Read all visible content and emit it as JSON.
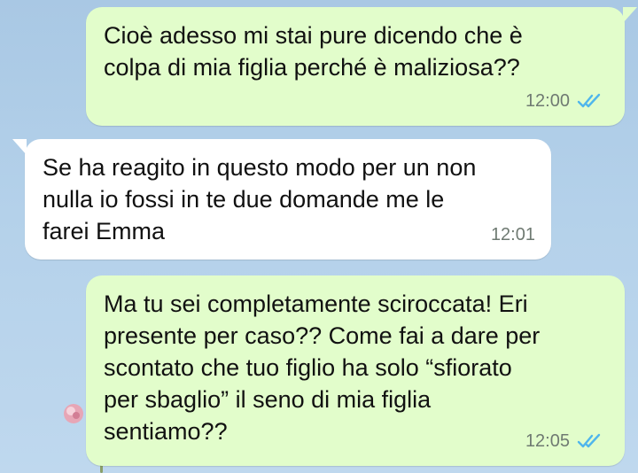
{
  "messages": [
    {
      "direction": "outgoing",
      "text_lines": [
        "Cioè adesso mi stai pure dicendo che è",
        "colpa di mia figlia perché è maliziosa??"
      ],
      "time": "12:00",
      "status": "read"
    },
    {
      "direction": "incoming",
      "text_lines": [
        "Se ha reagito in questo modo per un non",
        "nulla io fossi in te due domande me le",
        "farei Emma"
      ],
      "time": "12:01"
    },
    {
      "direction": "outgoing",
      "text_lines": [
        "Ma tu sei completamente sciroccata! Eri",
        "presente per caso?? Come fai a dare per",
        "scontato che tuo figlio ha solo “sfiorato",
        "per sbaglio” il seno di mia figlia",
        "sentiamo??"
      ],
      "time": "12:05",
      "status": "read"
    }
  ],
  "colors": {
    "outgoing_bubble": "#e2fdcb",
    "incoming_bubble": "#ffffff",
    "read_ticks": "#4fb6ec",
    "wallpaper": "#b4d1ea"
  }
}
